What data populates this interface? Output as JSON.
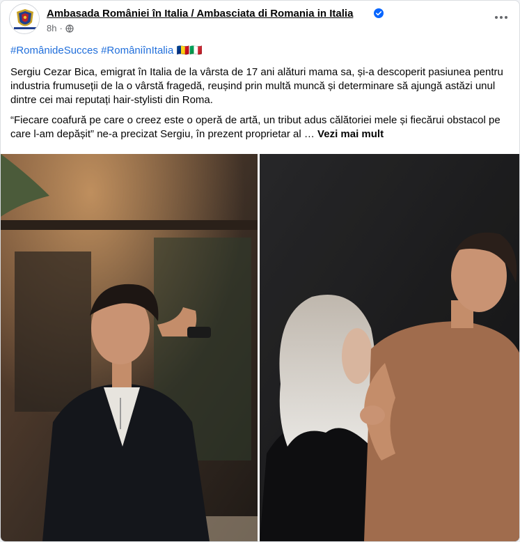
{
  "post": {
    "page_name": "Ambasada României în Italia / Ambasciata di Romania in Italia",
    "time": "8h",
    "separator": "·",
    "hashtags": "#RomânideSucces #RomâniînItalia 🇷🇴🇮🇹",
    "paragraph1": "Sergiu Cezar Bica, emigrat în Italia de la vârsta de 17 ani alături mama sa, și-a descoperit pasiunea pentru industria frumuseții de la o vârstă fragedă, reușind prin multă muncă și determinare să ajungă astăzi unul dintre cei mai reputați hair-stylisti din Roma.",
    "paragraph2": "“Fiecare coafură pe care o creez este o operă de artă, un tribut adus călătoriei mele și fiecărui obstacol pe care l-am depășit” ne-a precizat Sergiu, în prezent proprietar al …",
    "see_more": "Vezi mai mult"
  },
  "icons": {
    "avatar": "embassy-coat-of-arms",
    "verified": "verified-badge-icon",
    "audience": "globe-icon",
    "more": "more-options-icon"
  },
  "colors": {
    "link": "#216fdb",
    "verified": "#0866ff",
    "muted": "#65676b"
  },
  "photos": [
    {
      "name": "hairstylist-portrait"
    },
    {
      "name": "hairstylist-at-work"
    }
  ]
}
